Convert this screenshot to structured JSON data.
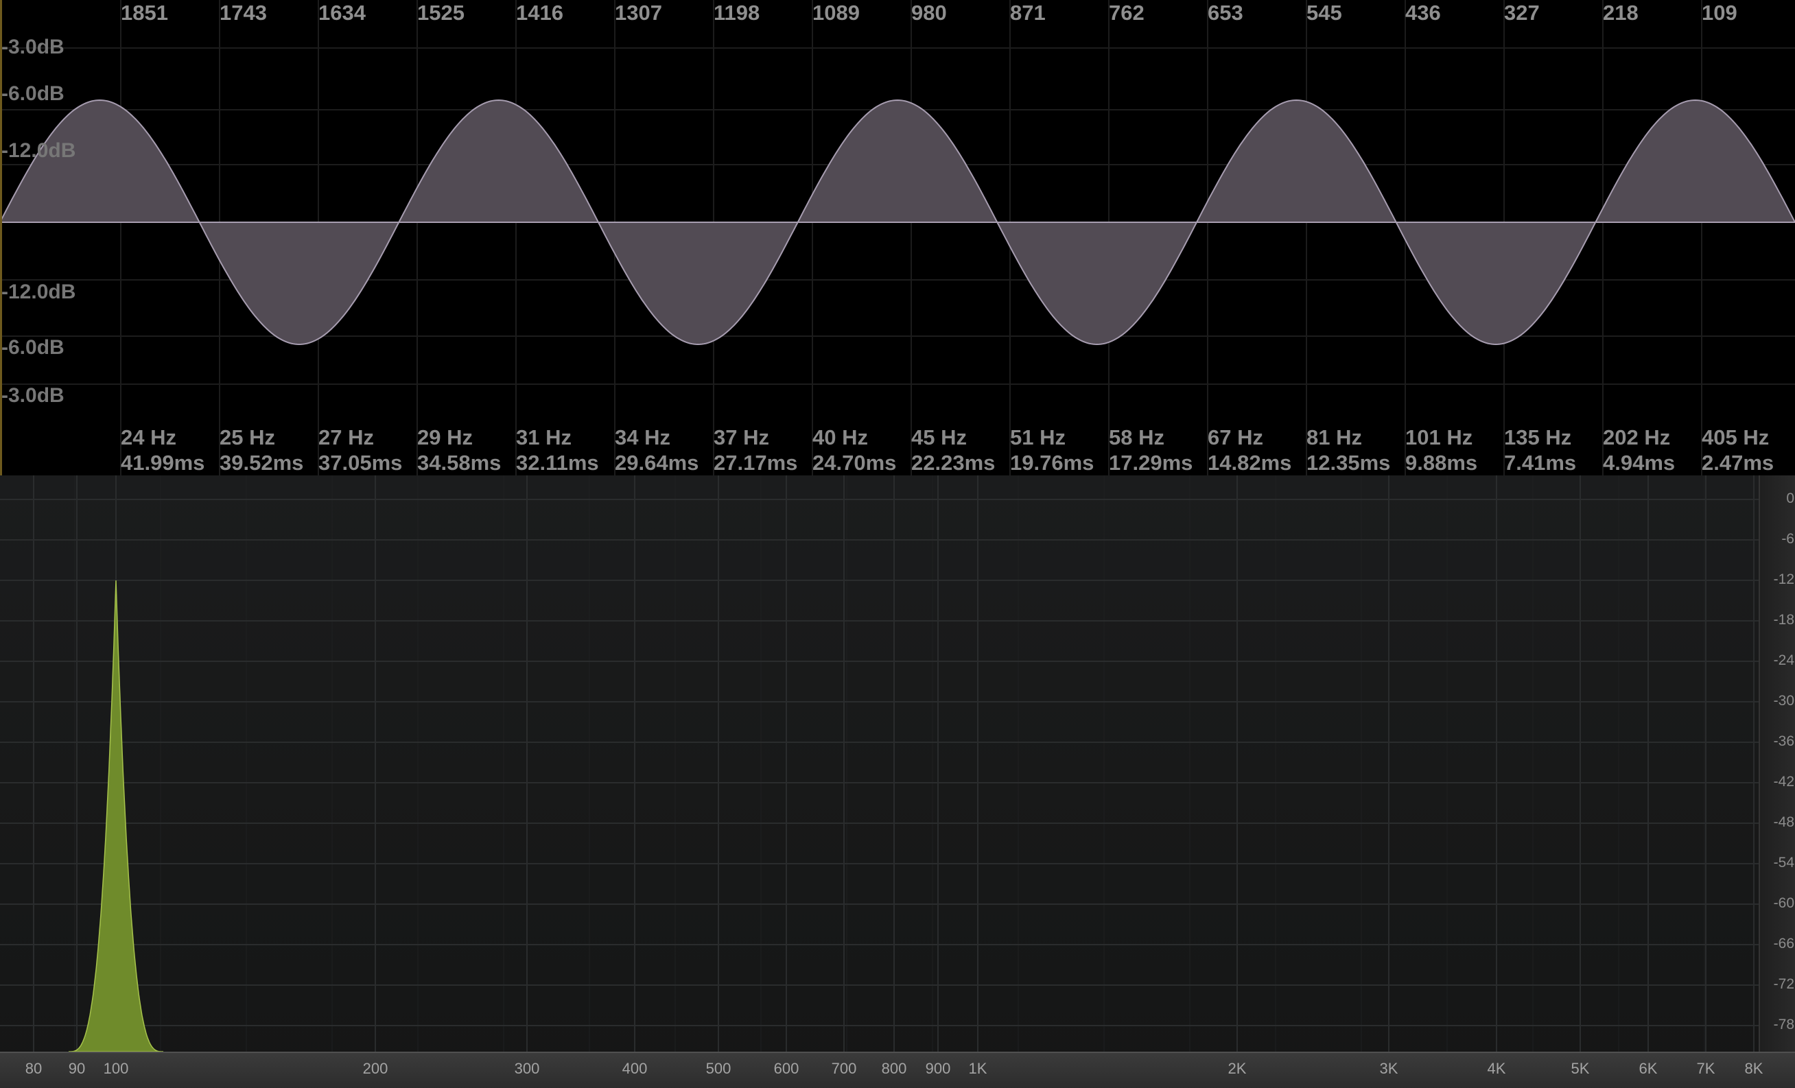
{
  "oscilloscope": {
    "sample_labels": [
      "1851",
      "1743",
      "1634",
      "1525",
      "1416",
      "1307",
      "1198",
      "1089",
      "980",
      "871",
      "762",
      "653",
      "545",
      "436",
      "327",
      "218",
      "109"
    ],
    "db_labels": [
      "-3.0dB",
      "-6.0dB",
      "-12.0dB",
      "-12.0dB",
      "-6.0dB",
      "-3.0dB"
    ],
    "freq_labels": [
      "24 Hz",
      "25 Hz",
      "27 Hz",
      "29 Hz",
      "31 Hz",
      "34 Hz",
      "37 Hz",
      "40 Hz",
      "45 Hz",
      "51 Hz",
      "58 Hz",
      "67 Hz",
      "81 Hz",
      "101 Hz",
      "135 Hz",
      "202 Hz",
      "405 Hz"
    ],
    "period_labels": [
      "41.99ms",
      "39.52ms",
      "37.05ms",
      "34.58ms",
      "32.11ms",
      "29.64ms",
      "27.17ms",
      "24.70ms",
      "22.23ms",
      "19.76ms",
      "17.29ms",
      "14.82ms",
      "12.35ms",
      "9.88ms",
      "7.41ms",
      "4.94ms",
      "2.47ms"
    ],
    "wave_cycles": 4.5,
    "wave_peak_db": -6.0,
    "colors": {
      "wave_fill": "#524b54",
      "wave_stroke": "#a79db0",
      "grid": "#1c1c1c",
      "background": "#000000"
    }
  },
  "analyzer": {
    "db_scale": [
      "0",
      "-6",
      "-12",
      "-18",
      "-24",
      "-30",
      "-36",
      "-42",
      "-48",
      "-54",
      "-60",
      "-66",
      "-72",
      "-78"
    ],
    "freq_ticks": [
      "80",
      "90",
      "100",
      "200",
      "300",
      "400",
      "500",
      "600",
      "700",
      "800",
      "900",
      "1K",
      "2K",
      "3K",
      "4K",
      "5K",
      "6K",
      "7K",
      "8K"
    ],
    "peak": {
      "frequency_hz": 100,
      "level_db": -12
    },
    "colors": {
      "peak_fill": "#6f8b2b",
      "peak_stroke": "#a6c24b",
      "grid": "#2a2c2d",
      "background": "#191a1a"
    }
  }
}
